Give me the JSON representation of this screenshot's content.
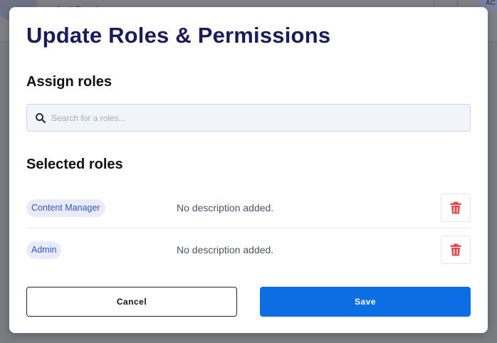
{
  "background": {
    "user_name": "Amit Gowdha",
    "badge": "AC"
  },
  "modal": {
    "title": "Update Roles & Permissions",
    "assign_title": "Assign roles",
    "search": {
      "placeholder": "Search for a roles...",
      "value": ""
    },
    "selected_title": "Selected roles",
    "roles": [
      {
        "name": "Content Manager",
        "description": "No description added."
      },
      {
        "name": "Admin",
        "description": "No description added."
      }
    ],
    "cancel_label": "Cancel",
    "save_label": "Save"
  },
  "icons": {
    "search": "search-icon",
    "delete": "trash-icon"
  },
  "colors": {
    "title": "#1a1a5c",
    "primary": "#0b6ee4",
    "danger": "#e5484d",
    "tag_bg": "#e9ebfb",
    "tag_text": "#2f56c4"
  }
}
